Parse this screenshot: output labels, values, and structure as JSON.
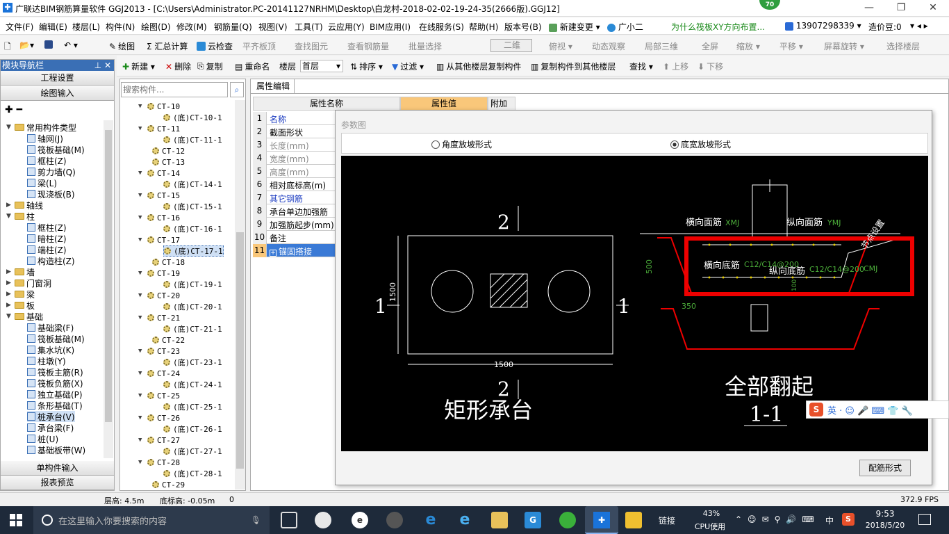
{
  "window": {
    "title": "广联达BIM钢筋算量软件 GGJ2013 - [C:\\Users\\Administrator.PC-20141127NRHM\\Desktop\\白龙村-2018-02-02-19-24-35(2666版).GGJ12]",
    "badge": "70",
    "minimize": "—",
    "restore": "❐",
    "close": "✕"
  },
  "menu": [
    "文件(F)",
    "编辑(E)",
    "楼层(L)",
    "构件(N)",
    "绘图(D)",
    "修改(M)",
    "钢筋量(Q)",
    "视图(V)",
    "工具(T)",
    "云应用(Y)",
    "BIM应用(I)",
    "在线服务(S)",
    "帮助(H)",
    "版本号(B)",
    "新建变更 ▾",
    "广小二",
    "为什么筏板XY方向布置...",
    "13907298339 ▾",
    "造价豆:0"
  ],
  "toolbar1": [
    "绘图",
    "Σ 汇总计算",
    "云检查",
    "平齐板顶",
    "查找图元",
    "查看钢筋量",
    "批量选择",
    "二维",
    "俯视 ▾",
    "动态观察",
    "局部三维",
    "全屏",
    "缩放 ▾",
    "平移 ▾",
    "屏幕旋转 ▾",
    "选择楼层"
  ],
  "toolbar2": [
    "新建 ▾",
    "删除",
    "复制",
    "重命名",
    "楼层",
    "首层",
    "排序 ▾",
    "过滤 ▾",
    "从其他楼层复制构件",
    "复制构件到其他楼层",
    "查找 ▾",
    "上移",
    "下移"
  ],
  "leftpanel": {
    "header": "模块导航栏",
    "pin": "⊥ ✕",
    "btn_top1": "工程设置",
    "btn_top2": "绘图输入",
    "btn_bot1": "单构件输入",
    "btn_bot2": "报表预览",
    "tree": [
      "常用构件类型",
      "轴网(J)",
      "筏板基础(M)",
      "框柱(Z)",
      "剪力墙(Q)",
      "梁(L)",
      "现浇板(B)",
      "轴线",
      "柱",
      "框柱(Z)",
      "暗柱(Z)",
      "端柱(Z)",
      "构造柱(Z)",
      "墙",
      "门窗洞",
      "梁",
      "板",
      "基础",
      "基础梁(F)",
      "筏板基础(M)",
      "集水坑(K)",
      "柱墩(Y)",
      "筏板主筋(R)",
      "筏板负筋(X)",
      "独立基础(P)",
      "条形基础(T)",
      "桩承台(V)",
      "承台梁(F)",
      "桩(U)",
      "基础板带(W)"
    ]
  },
  "midpanel": {
    "search_placeholder": "搜索构件...",
    "items": [
      "CT-10",
      "(底)CT-10-1",
      "CT-11",
      "(底)CT-11-1",
      "CT-12",
      "CT-13",
      "CT-14",
      "(底)CT-14-1",
      "CT-15",
      "(底)CT-15-1",
      "CT-16",
      "(底)CT-16-1",
      "CT-17",
      "(底)CT-17-1",
      "CT-18",
      "CT-19",
      "(底)CT-19-1",
      "CT-20",
      "(底)CT-20-1",
      "CT-21",
      "(底)CT-21-1",
      "CT-22",
      "CT-23",
      "(底)CT-23-1",
      "CT-24",
      "(底)CT-24-1",
      "CT-25",
      "(底)CT-25-1",
      "CT-26",
      "(底)CT-26-1",
      "CT-27",
      "(底)CT-27-1",
      "CT-28",
      "(底)CT-28-1",
      "CT-29"
    ]
  },
  "props": {
    "tab": "属性编辑",
    "col_name": "属性名称",
    "col_value": "属性值",
    "col_extra": "附加",
    "rows": [
      {
        "n": "1",
        "name": "名称"
      },
      {
        "n": "2",
        "name": "截面形状"
      },
      {
        "n": "3",
        "name": "长度(mm)"
      },
      {
        "n": "4",
        "name": "宽度(mm)"
      },
      {
        "n": "5",
        "name": "高度(mm)"
      },
      {
        "n": "6",
        "name": "相对底标高(m)"
      },
      {
        "n": "7",
        "name": "其它钢筋"
      },
      {
        "n": "8",
        "name": "承台单边加强筋"
      },
      {
        "n": "9",
        "name": "加强筋起步(mm)"
      },
      {
        "n": "10",
        "name": "备注"
      },
      {
        "n": "11",
        "name": "锚固搭接"
      }
    ]
  },
  "dialog": {
    "title": "参数图",
    "radio1": "角度放坡形式",
    "radio2": "底宽放坡形式",
    "button": "配筋形式",
    "cad": {
      "left_title": "矩形承台",
      "right_title": "全部翻起",
      "section": "1-1",
      "dim1500a": "1500",
      "dim1500b": "1500",
      "lab2": "2",
      "lab1": "1",
      "d500": "500",
      "d350": "350",
      "hmj": "横向面筋",
      "xmj": "XMJ",
      "zmj": "纵向面筋",
      "ymj": "YMJ",
      "hdj": "横向底筋",
      "c1": "C12/C14@200",
      "zdj": "纵向底筋",
      "c2": "C12/C14@200",
      "cmj": "CMJ",
      "slope": "节点设置",
      "d100": "100"
    }
  },
  "ime": {
    "text": "英 ‧ ☺ 🎤 ⌨ 👕 🔧"
  },
  "status": {
    "floor_height": "层高: 4.5m",
    "bottom": "底标高: -0.05m",
    "zero": "0",
    "fps": "372.9 FPS"
  },
  "taskbar": {
    "search": "在这里输入你要搜索的内容",
    "link": "链接",
    "cpu_pct": "43%",
    "cpu_label": "CPU使用",
    "ime": "中",
    "time": "9:53",
    "date": "2018/5/20"
  }
}
